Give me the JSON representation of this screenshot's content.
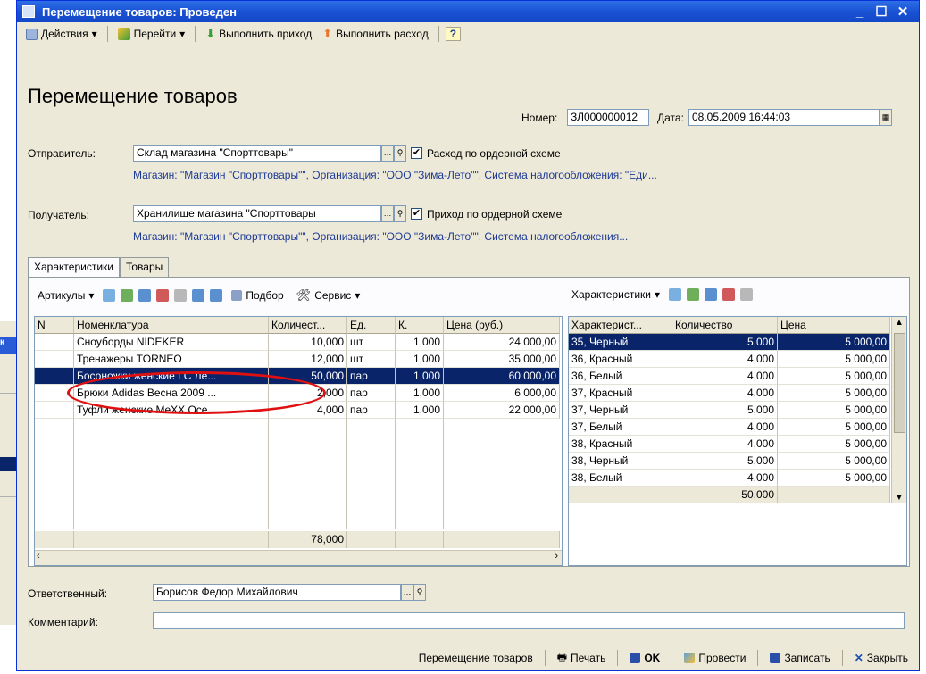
{
  "window": {
    "title": "Перемещение товаров: Проведен",
    "controls": [
      "_",
      "☐",
      "✕"
    ]
  },
  "toolbar": {
    "actions": "Действия",
    "goto": "Перейти",
    "do_income": "Выполнить приход",
    "do_expense": "Выполнить расход",
    "help": "?"
  },
  "doc": {
    "title": "Перемещение товаров",
    "number_label": "Номер:",
    "number": "ЗЛ000000012",
    "date_label": "Дата:",
    "date": "08.05.2009 16:44:03"
  },
  "sender": {
    "label": "Отправитель:",
    "value": "Склад магазина \"Спорттовары\"",
    "checkbox_label": "Расход по ордерной схеме",
    "checked": "✔",
    "info": "Магазин: \"Магазин \"Спорттовары\"\", Организация: \"ООО \"Зима-Лето\"\", Система налогообложения: \"Еди..."
  },
  "receiver": {
    "label": "Получатель:",
    "value": "Хранилище магазина \"Спорттовары",
    "checkbox_label": "Приход по ордерной схеме",
    "checked": "✔",
    "info": "Магазин: \"Магазин \"Спорттовары\"\", Организация: \"ООО \"Зима-Лето\"\", Система налогообложения..."
  },
  "tabs": [
    "Характеристики",
    "Товары"
  ],
  "left_toolbar": {
    "articles": "Артикулы",
    "pick": "Подбор",
    "service": "Сервис"
  },
  "right_toolbar": {
    "chars": "Характеристики"
  },
  "left_grid": {
    "headers": [
      "N",
      "Номенклатура",
      "Количест...",
      "Ед.",
      "К.",
      "Цена (руб.)"
    ],
    "rows": [
      {
        "name": "Сноуборды NIDEKER",
        "qty": "10,000",
        "unit": "шт",
        "k": "1,000",
        "price": "24 000,00"
      },
      {
        "name": "Тренажеры TORNEO",
        "qty": "12,000",
        "unit": "шт",
        "k": "1,000",
        "price": "35 000,00"
      },
      {
        "name": "Босоножки женские LC Ле...",
        "qty": "50,000",
        "unit": "пар",
        "k": "1,000",
        "price": "60 000,00"
      },
      {
        "name": "Брюки Adidas Весна 2009 ...",
        "qty": "2,000",
        "unit": "пар",
        "k": "1,000",
        "price": "6 000,00"
      },
      {
        "name": "Туфли женские MeXX Осе...",
        "qty": "4,000",
        "unit": "пар",
        "k": "1,000",
        "price": "22 000,00"
      }
    ],
    "total_qty": "78,000"
  },
  "right_grid": {
    "headers": [
      "Характерист...",
      "Количество",
      "Цена"
    ],
    "rows": [
      {
        "c": "35, Черный",
        "q": "5,000",
        "p": "5 000,00"
      },
      {
        "c": "36, Красный",
        "q": "4,000",
        "p": "5 000,00"
      },
      {
        "c": "36, Белый",
        "q": "4,000",
        "p": "5 000,00"
      },
      {
        "c": "37, Красный",
        "q": "4,000",
        "p": "5 000,00"
      },
      {
        "c": "37, Черный",
        "q": "5,000",
        "p": "5 000,00"
      },
      {
        "c": "37, Белый",
        "q": "4,000",
        "p": "5 000,00"
      },
      {
        "c": "38, Красный",
        "q": "4,000",
        "p": "5 000,00"
      },
      {
        "c": "38, Черный",
        "q": "5,000",
        "p": "5 000,00"
      },
      {
        "c": "38, Белый",
        "q": "4,000",
        "p": "5 000,00"
      }
    ],
    "total_qty": "50,000"
  },
  "responsible": {
    "label": "Ответственный:",
    "value": "Борисов Федор Михайлович"
  },
  "comment": {
    "label": "Комментарий:",
    "value": ""
  },
  "statusbar": {
    "doc_type": "Перемещение товаров",
    "print": "Печать",
    "ok": "OK",
    "post": "Провести",
    "save": "Записать",
    "close": "Закрыть"
  },
  "background_window": {
    "title_fragment": "к"
  },
  "colors": {
    "titlebar": "#1952d4",
    "selection": "#0a246a",
    "info_text": "#1e3a96",
    "highlight_oval": "#e01010"
  }
}
